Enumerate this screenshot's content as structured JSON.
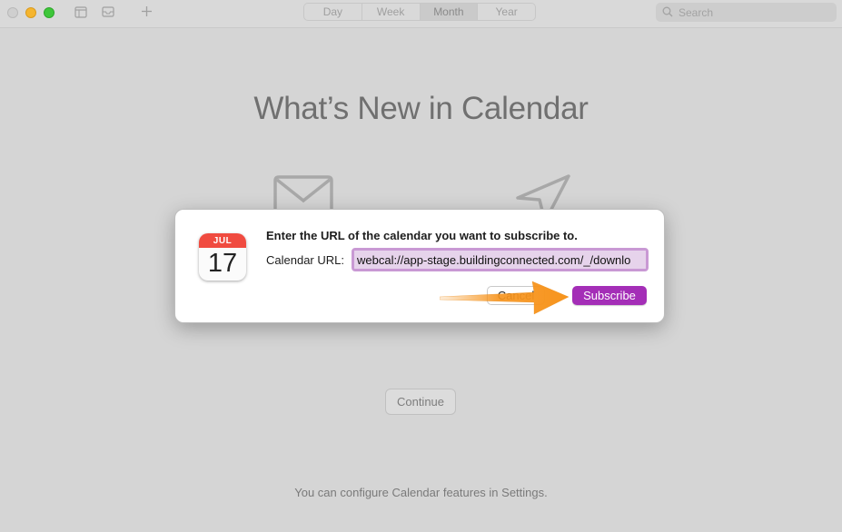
{
  "toolbar": {
    "segments": [
      "Day",
      "Week",
      "Month",
      "Year"
    ],
    "active_segment": "Month",
    "search_placeholder": "Search"
  },
  "main": {
    "title": "What’s New in Calendar",
    "continue_label": "Continue",
    "footer_text": "You can configure Calendar features in Settings."
  },
  "dialog": {
    "heading": "Enter the URL of the calendar you want to subscribe to.",
    "url_label": "Calendar URL:",
    "url_value": "webcal://app-stage.buildingconnected.com/_/downlo",
    "cancel_label": "Cancel",
    "subscribe_label": "Subscribe",
    "calendar_icon": {
      "month": "JUL",
      "day": "17"
    }
  },
  "colors": {
    "accent": "#a42eb7",
    "arrow": "#f7941d",
    "calendar_icon_red": "#f04b40"
  },
  "icons": [
    "calendar-list-icon",
    "inbox-icon",
    "add-icon",
    "search-icon",
    "envelope-icon",
    "location-arrow-icon"
  ]
}
